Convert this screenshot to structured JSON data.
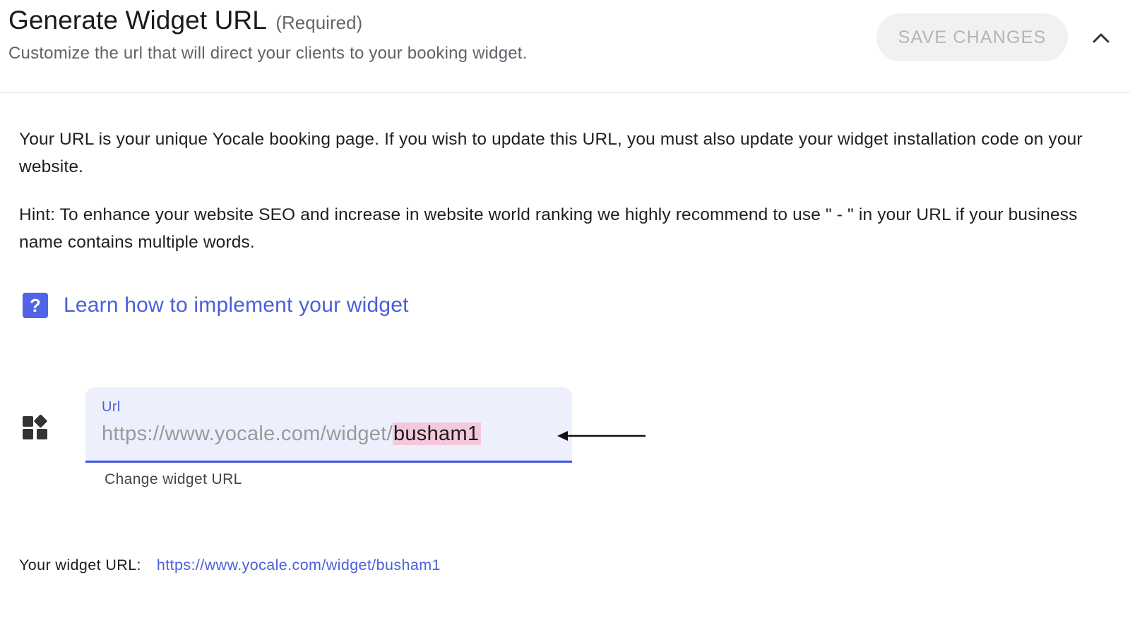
{
  "header": {
    "title": "Generate Widget URL",
    "required": "(Required)",
    "subtitle": "Customize the url that will direct your clients to your booking widget.",
    "save_label": "SAVE CHANGES",
    "collapse_icon": "chevron-up-icon"
  },
  "content": {
    "paragraph1": "Your URL is your unique Yocale booking page. If you wish to update this URL, you must also update your widget installation code on your website.",
    "paragraph2": "Hint: To enhance your website SEO and increase in website world ranking we highly recommend to use \" - \" in your URL if your business name contains multiple words.",
    "help_icon": "question-mark-icon",
    "help_icon_glyph": "?",
    "learn_link": "Learn how to implement your widget"
  },
  "url_field": {
    "icon": "widgets-icon",
    "label": "Url",
    "prefix": "https://www.yocale.com/widget/",
    "value": "busham1",
    "helper": "Change widget URL",
    "annotation_icon": "arrow-left-icon"
  },
  "widget_url": {
    "label": "Your widget URL:",
    "link": "https://www.yocale.com/widget/busham1"
  },
  "colors": {
    "accent": "#4b5fd9",
    "field_background": "#eeeffc",
    "field_underline": "#3d57df",
    "highlight": "#f4c8dd",
    "button_background": "#f1f1f1",
    "button_text": "#b5b5b5"
  }
}
